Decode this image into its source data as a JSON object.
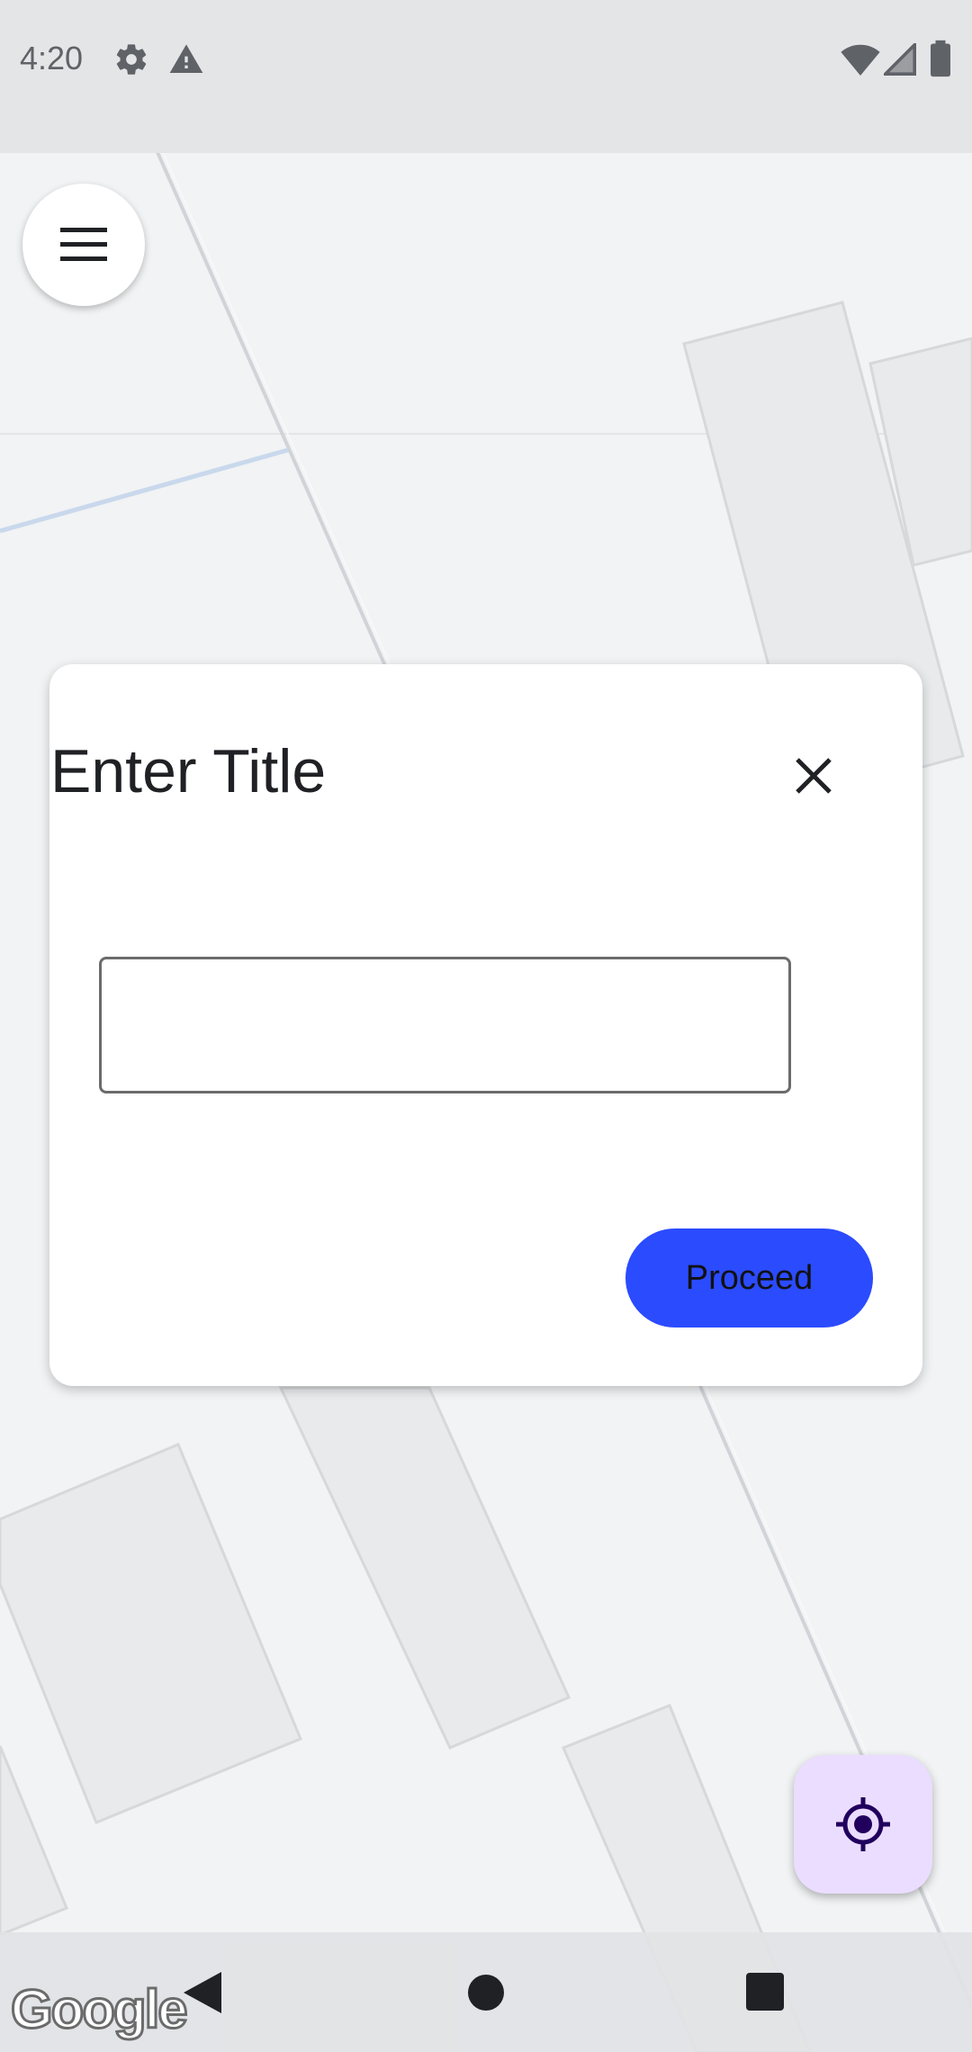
{
  "status_bar": {
    "time": "4:20",
    "icons": [
      "gear-icon",
      "warning-icon",
      "wifi-icon",
      "signal-icon",
      "battery-icon"
    ]
  },
  "map": {
    "attribution": "Google",
    "colors": {
      "background": "#f1f3f4",
      "building_fill": "#e8eaeb",
      "building_stroke": "#d6d8da",
      "road": "#d0d4d8",
      "water_line": "#c9d8ec"
    }
  },
  "menu_button": {
    "icon": "hamburger-menu-icon"
  },
  "dialog": {
    "title": "Enter Title",
    "close_icon": "close-icon",
    "input": {
      "value": "",
      "placeholder": ""
    },
    "proceed_label": "Proceed"
  },
  "locate_button": {
    "icon": "my-location-icon"
  },
  "nav_bar": {
    "back_icon": "back-triangle-icon",
    "home_icon": "home-circle-icon",
    "recents_icon": "recents-square-icon"
  },
  "colors": {
    "accent": "#2b4bff",
    "fab_background": "#eaddff",
    "locate_icon": "#21005d"
  }
}
